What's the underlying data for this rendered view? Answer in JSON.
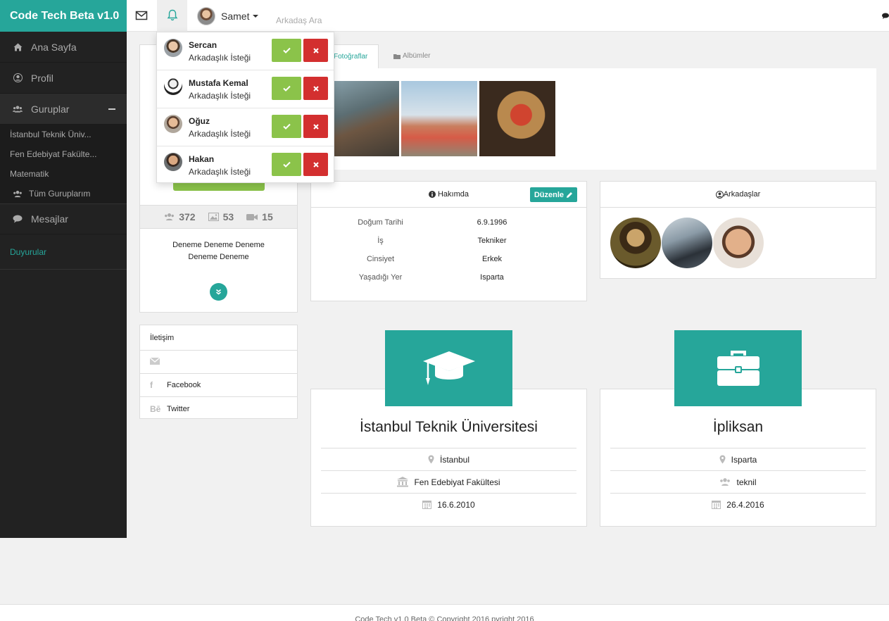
{
  "brand": "Code Tech Beta v1.0",
  "topbar": {
    "user_name": "Samet",
    "search_placeholder": "Arkadaş Ara"
  },
  "sidebar": {
    "items": [
      {
        "label": "Ana Sayfa",
        "icon": "home-icon"
      },
      {
        "label": "Profil",
        "icon": "user-icon"
      },
      {
        "label": "Guruplar",
        "icon": "users-icon"
      }
    ],
    "groups": [
      "İstanbul Teknik Üniv...",
      "Fen Edebiyat Fakülte...",
      "Matematik"
    ],
    "all_groups": "Tüm Guruplarım",
    "messages": "Mesajlar",
    "announcements": "Duyurular"
  },
  "notifications": [
    {
      "name": "Sercan",
      "sub": "Arkadaşlık İsteği"
    },
    {
      "name": "Mustafa Kemal",
      "sub": "Arkadaşlık İsteği"
    },
    {
      "name": "Oğuz",
      "sub": "Arkadaşlık İsteği"
    },
    {
      "name": "Hakan",
      "sub": "Arkadaşlık İsteği"
    }
  ],
  "profile": {
    "stats": {
      "friends": "372",
      "photos": "53",
      "videos": "15"
    },
    "bio_line1": "Deneme Deneme Deneme",
    "bio_line2": "Deneme Deneme"
  },
  "contact": {
    "title": "İletişim",
    "facebook": "Facebook",
    "twitter": "Twitter"
  },
  "tabs": {
    "photos": "Fotoğraflar",
    "albums": "Albümler"
  },
  "about": {
    "title": "Hakımda",
    "edit": "Düzenle",
    "rows": [
      {
        "k": "Doğum Tarihi",
        "v": "6.9.1996"
      },
      {
        "k": "İş",
        "v": "Tekniker"
      },
      {
        "k": "Cinsiyet",
        "v": "Erkek"
      },
      {
        "k": "Yaşadığı Yer",
        "v": "Isparta"
      }
    ]
  },
  "friends": {
    "title": "Arkadaşlar"
  },
  "education": {
    "title": "İstanbul Teknik Üniversitesi",
    "city": "İstanbul",
    "faculty": "Fen Edebiyat Fakültesi",
    "date": "16.6.2010"
  },
  "work": {
    "title": "İpliksan",
    "city": "Isparta",
    "position": "teknil",
    "date": "26.4.2016"
  },
  "footer": "Code Tech v1.0 Beta © Copyright 2016 pyright 2016",
  "colors": {
    "accent": "#26a69a",
    "accept": "#8bc34a",
    "reject": "#d32f2f",
    "sidebar": "#222222"
  }
}
